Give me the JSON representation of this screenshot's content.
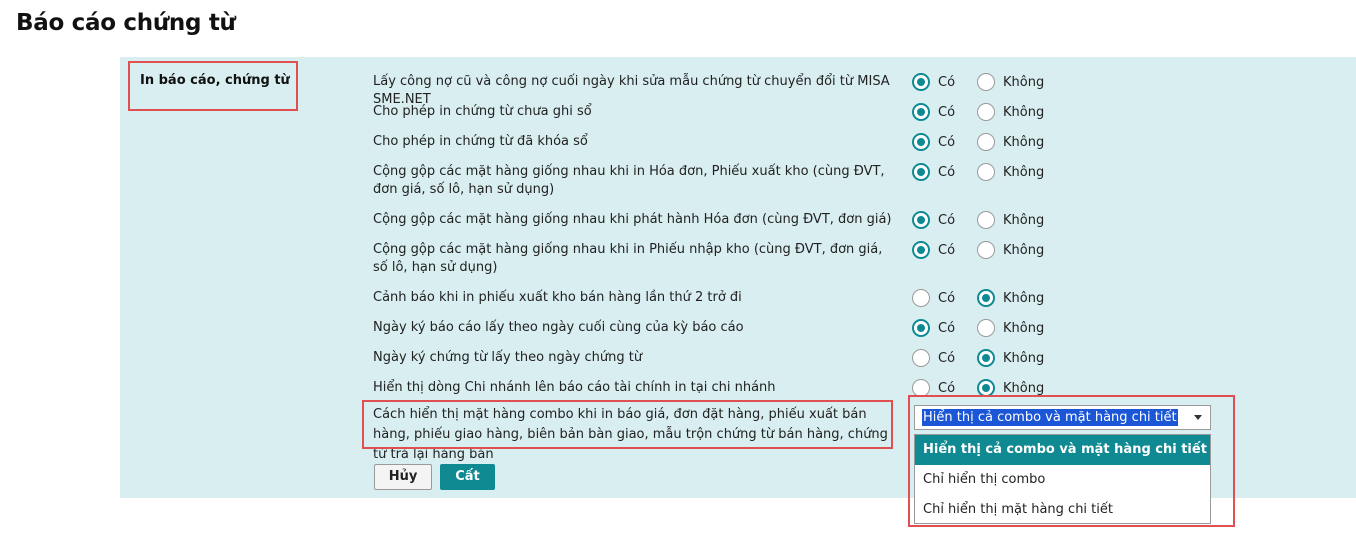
{
  "page": {
    "title": "Báo cáo chứng từ"
  },
  "section": {
    "label": "In báo cáo, chứng từ"
  },
  "options": {
    "yes_label": "Có",
    "no_label": "Không"
  },
  "rows": [
    {
      "label": "Lấy công nợ cũ và công nợ cuối ngày khi sửa mẫu chứng từ chuyển đổi từ MISA SME.NET",
      "selected": "yes"
    },
    {
      "label": "Cho phép in chứng từ chưa ghi sổ",
      "selected": "yes"
    },
    {
      "label": "Cho phép in chứng từ đã khóa sổ",
      "selected": "yes"
    },
    {
      "label": "Cộng gộp các mặt hàng giống nhau khi in Hóa đơn, Phiếu xuất kho (cùng ĐVT, đơn giá, số lô, hạn sử dụng)",
      "selected": "yes"
    },
    {
      "label": "Cộng gộp các mặt hàng giống nhau khi phát hành Hóa đơn (cùng ĐVT, đơn giá)",
      "selected": "yes"
    },
    {
      "label": "Cộng gộp các mặt hàng giống nhau khi in Phiếu nhập kho (cùng ĐVT, đơn giá, số lô, hạn sử dụng)",
      "selected": "yes"
    },
    {
      "label": "Cảnh báo khi in phiếu xuất kho bán hàng lần thứ 2 trở đi",
      "selected": "no"
    },
    {
      "label": "Ngày ký báo cáo lấy theo ngày cuối cùng của kỳ báo cáo",
      "selected": "yes"
    },
    {
      "label": "Ngày ký chứng từ lấy theo ngày chứng từ",
      "selected": "no"
    },
    {
      "label": "Hiển thị dòng Chi nhánh lên báo cáo tài chính in tại chi nhánh",
      "selected": "no"
    }
  ],
  "combo_setting": {
    "label": "Cách hiển thị mặt hàng combo khi in báo giá, đơn đặt hàng, phiếu xuất bán hàng, phiếu giao hàng, biên bản bàn giao, mẫu trộn chứng từ bán hàng, chứng từ trả lại hàng bán",
    "selected_value": "Hiển thị cả combo và mặt hàng chi tiết",
    "dropdown_options": [
      "Hiển thị cả combo và mặt hàng chi tiết",
      "Chỉ hiển thị combo",
      "Chỉ hiển thị mặt hàng chi tiết"
    ]
  },
  "buttons": {
    "cancel": "Hủy",
    "save": "Cất"
  },
  "colors": {
    "accent": "#0f8a93",
    "panel_bg": "#d9eef0",
    "highlight_border": "#e05050",
    "text_selection": "#1a56d6"
  }
}
